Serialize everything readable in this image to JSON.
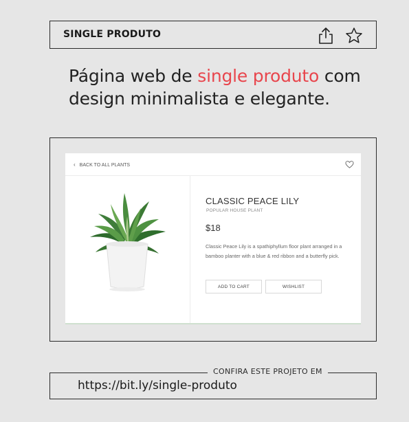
{
  "header": {
    "title": "SINGLE PRODUTO",
    "share_icon": "share-icon",
    "star_icon": "star-icon"
  },
  "headline": {
    "before": "Página web de ",
    "accent": "single produto",
    "after": " com design minimalista e elegante.",
    "accent_color": "#e8464d"
  },
  "mockup": {
    "back_link": "BACK TO ALL PLANTS",
    "back_icon": "chevron-left-icon",
    "favorite_icon": "heart-icon",
    "product": {
      "name": "CLASSIC PEACE LILY",
      "subtitle": "POPULAR HOUSE PLANT",
      "price": "$18",
      "description": "Classic Peace Lily is a spathiphyllum floor plant arranged in a bamboo planter with a blue & red ribbon and a butterfly pick."
    },
    "buttons": {
      "add_to_cart": "ADD TO CART",
      "wishlist": "WISHLIST"
    }
  },
  "footer": {
    "label": "CONFIRA ESTE PROJETO EM",
    "url": "https://bit.ly/single-produto"
  }
}
